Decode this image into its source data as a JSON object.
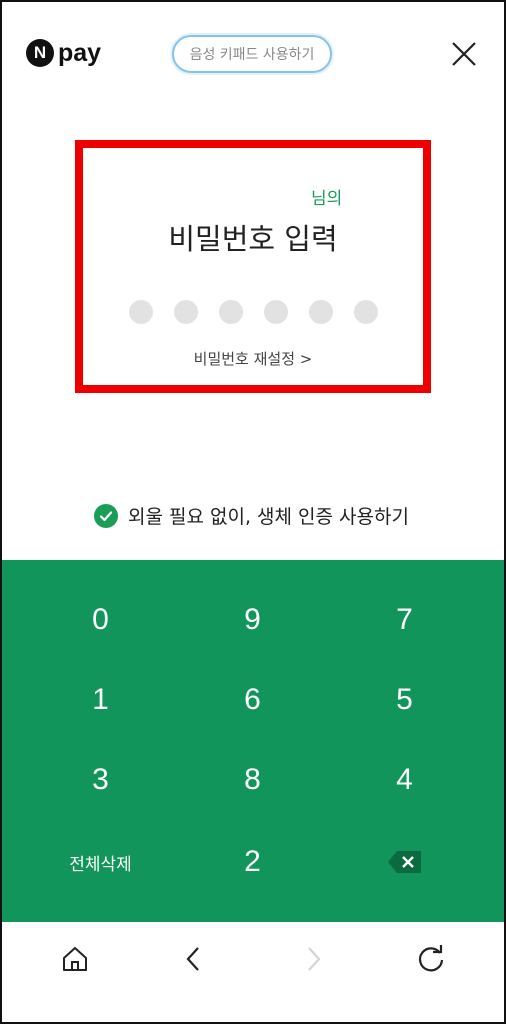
{
  "header": {
    "logo_mark": "N",
    "logo_text": "pay",
    "voice_keypad_label": "음성 키패드 사용하기"
  },
  "password": {
    "owner_suffix": "님의",
    "title": "비밀번호 입력",
    "dot_count": 6,
    "reset_label": "비밀번호 재설정 >"
  },
  "biometric": {
    "label": "외울 필요 없이, 생체 인증 사용하기"
  },
  "keypad": {
    "keys": [
      "0",
      "9",
      "7",
      "1",
      "6",
      "5",
      "3",
      "8",
      "4",
      "전체삭제",
      "2",
      "backspace-icon"
    ]
  },
  "colors": {
    "accent_green": "#12955a",
    "highlight_red": "#ee0000",
    "voice_border": "#87c1ee"
  },
  "navbar": {
    "icons": [
      "home-icon",
      "back-icon",
      "forward-icon",
      "refresh-icon"
    ]
  }
}
